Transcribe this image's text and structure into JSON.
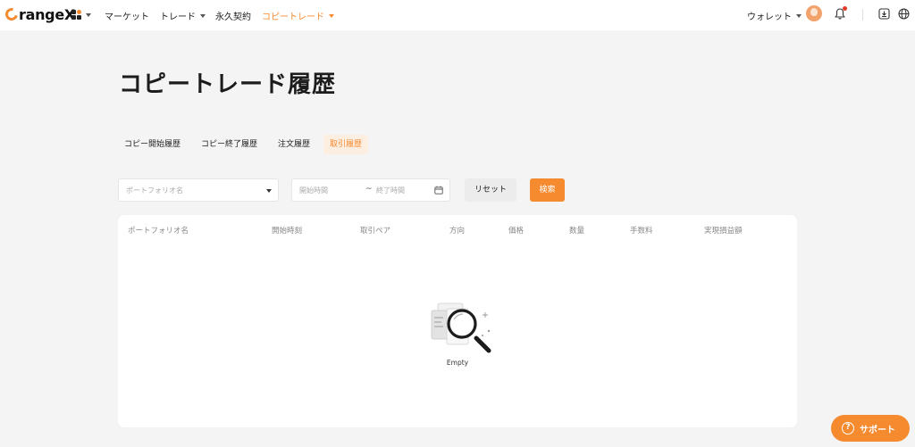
{
  "header": {
    "logo_text": "rangeX",
    "nav": [
      {
        "label": "マーケット"
      },
      {
        "label": "トレード"
      },
      {
        "label": "永久契約"
      },
      {
        "label": "コピートレード"
      }
    ],
    "wallet_label": "ウォレット",
    "icons": [
      "apps-grid-icon",
      "avatar",
      "bell-icon",
      "download-icon",
      "globe-icon"
    ],
    "notification_dot_color": "#e5392b"
  },
  "page": {
    "title": "コピートレード履歴",
    "tabs": [
      {
        "label": "コピー開始履歴",
        "active": false
      },
      {
        "label": "コピー終了履歴",
        "active": false
      },
      {
        "label": "注文履歴",
        "active": false
      },
      {
        "label": "取引履歴",
        "active": true
      }
    ]
  },
  "filters": {
    "portfolio_placeholder": "ポートフォリオ名",
    "start_placeholder": "開始時間",
    "range_separator": "~",
    "end_placeholder": "終了時間",
    "reset_label": "リセット",
    "search_label": "検索"
  },
  "table": {
    "columns": [
      "ポートフォリオ名",
      "開始時刻",
      "取引ペア",
      "方向",
      "価格",
      "数量",
      "手数料",
      "実現損益額"
    ],
    "rows": [],
    "empty_text": "Empty"
  },
  "support": {
    "label": "サポート"
  },
  "colors": {
    "accent": "#f58a2f",
    "accent_light": "#fdeee2",
    "background": "#f4f4f5"
  }
}
